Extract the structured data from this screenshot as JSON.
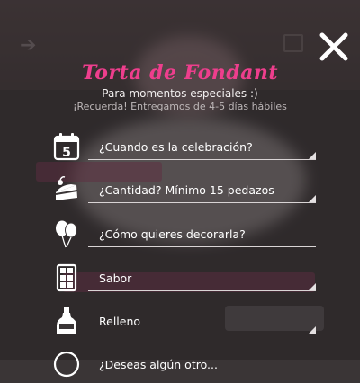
{
  "modal": {
    "title": "Torta de Fondant",
    "subtitle": "Para momentos especiales :)",
    "note": "¡Recuerda! Entregamos de 4-5 días hábiles"
  },
  "calendar_day": "5",
  "fields": [
    {
      "label": "¿Cuando es la celebración?",
      "icon": "calendar-icon"
    },
    {
      "label": "¿Cantidad? Mínimo 15 pedazos",
      "icon": "cake-slice-icon"
    },
    {
      "label": "¿Cómo quieres decorarla?",
      "icon": "balloons-icon"
    },
    {
      "label": "Sabor",
      "icon": "chocolate-bar-icon"
    },
    {
      "label": "Relleno",
      "icon": "bottle-icon"
    }
  ],
  "partial_field": {
    "label": "¿Deseas algún otro...",
    "icon": "clock-icon"
  },
  "colors": {
    "accent": "#ee3e8d",
    "overlay": "#2a2627",
    "line": "#d9d4d5"
  }
}
